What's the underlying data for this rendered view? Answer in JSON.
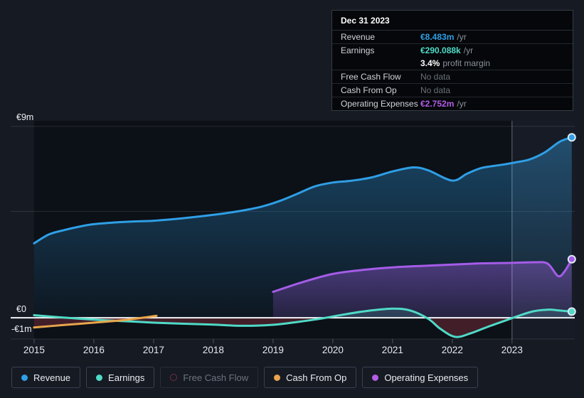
{
  "tooltip": {
    "date": "Dec 31 2023",
    "revenue": {
      "label": "Revenue",
      "value": "€8.483m",
      "suffix": "/yr"
    },
    "earnings": {
      "label": "Earnings",
      "value": "€290.088k",
      "suffix": "/yr",
      "margin_value": "3.4%",
      "margin_label": "profit margin"
    },
    "free_cash_flow": {
      "label": "Free Cash Flow",
      "value": "No data"
    },
    "cash_from_op": {
      "label": "Cash From Op",
      "value": "No data"
    },
    "operating_expenses": {
      "label": "Operating Expenses",
      "value": "€2.752m",
      "suffix": "/yr"
    }
  },
  "y_axis": {
    "top": "€9m",
    "zero": "€0",
    "bottom": "-€1m"
  },
  "legend": {
    "items": [
      {
        "label": "Revenue",
        "key": "revenue"
      },
      {
        "label": "Earnings",
        "key": "earnings"
      },
      {
        "label": "Free Cash Flow",
        "key": "fcf"
      },
      {
        "label": "Cash From Op",
        "key": "cashop"
      },
      {
        "label": "Operating Expenses",
        "key": "opex"
      }
    ]
  },
  "colors": {
    "revenue": "#2f9fe6",
    "earnings": "#4fdac6",
    "opex": "#b45ce8",
    "cashop": "#e8a54b",
    "fcf": "#6e2f40",
    "background": "#161a23",
    "plot_dark": "#0c1017",
    "zero_line": "#f2f4f7"
  },
  "chart_data": {
    "type": "area",
    "title": "Earnings and revenue history",
    "currency": "EUR",
    "unit": "millions",
    "xlim": [
      2014.608,
      2024.05
    ],
    "ylim": [
      -1.0,
      9.26
    ],
    "x_ticks": [
      2015,
      2016,
      2017,
      2018,
      2019,
      2020,
      2021,
      2022,
      2023
    ],
    "y_gridlines": [
      9,
      5,
      -1
    ],
    "y_tick_labels": [
      {
        "text": "€9m",
        "value": 9
      },
      {
        "text": "€0",
        "value": 0
      },
      {
        "text": "-€1m",
        "value": -1
      }
    ],
    "highlight": {
      "from_year": 2023,
      "to_year": 2024.05
    },
    "series": [
      {
        "key": "revenue",
        "name": "Revenue",
        "color": "#2f9fe6",
        "end_marker": true,
        "points": [
          [
            2015,
            3.5
          ],
          [
            2015.25,
            3.92
          ],
          [
            2015.5,
            4.12
          ],
          [
            2015.75,
            4.28
          ],
          [
            2016,
            4.4
          ],
          [
            2016.35,
            4.48
          ],
          [
            2016.7,
            4.53
          ],
          [
            2017,
            4.56
          ],
          [
            2017.5,
            4.68
          ],
          [
            2018,
            4.84
          ],
          [
            2018.4,
            5.0
          ],
          [
            2018.8,
            5.22
          ],
          [
            2019.1,
            5.48
          ],
          [
            2019.4,
            5.82
          ],
          [
            2019.7,
            6.18
          ],
          [
            2020,
            6.36
          ],
          [
            2020.3,
            6.44
          ],
          [
            2020.65,
            6.6
          ],
          [
            2021,
            6.88
          ],
          [
            2021.35,
            7.07
          ],
          [
            2021.6,
            6.93
          ],
          [
            2022,
            6.45
          ],
          [
            2022.25,
            6.78
          ],
          [
            2022.5,
            7.05
          ],
          [
            2022.8,
            7.18
          ],
          [
            2023.05,
            7.3
          ],
          [
            2023.3,
            7.45
          ],
          [
            2023.55,
            7.78
          ],
          [
            2023.8,
            8.28
          ],
          [
            2024,
            8.483
          ]
        ]
      },
      {
        "key": "opex",
        "name": "Operating Expenses",
        "color": "#a55ce8",
        "end_marker": true,
        "points": [
          [
            2019,
            1.22
          ],
          [
            2019.5,
            1.68
          ],
          [
            2020,
            2.06
          ],
          [
            2020.5,
            2.25
          ],
          [
            2021,
            2.37
          ],
          [
            2021.5,
            2.44
          ],
          [
            2022,
            2.5
          ],
          [
            2022.5,
            2.56
          ],
          [
            2023,
            2.58
          ],
          [
            2023.4,
            2.61
          ],
          [
            2023.6,
            2.54
          ],
          [
            2023.77,
            1.96
          ],
          [
            2023.88,
            2.18
          ],
          [
            2024,
            2.752
          ]
        ]
      },
      {
        "key": "earnings",
        "name": "Earnings",
        "color": "#4fdac6",
        "end_marker": true,
        "pos_fill": "rgba(79,218,198,0.16)",
        "neg_fill": "rgba(214,72,94,0.27)",
        "points": [
          [
            2015,
            0.12
          ],
          [
            2015.4,
            0.03
          ],
          [
            2015.8,
            -0.05
          ],
          [
            2016.2,
            -0.12
          ],
          [
            2016.6,
            -0.17
          ],
          [
            2017,
            -0.23
          ],
          [
            2017.5,
            -0.28
          ],
          [
            2018,
            -0.32
          ],
          [
            2018.5,
            -0.38
          ],
          [
            2019,
            -0.33
          ],
          [
            2019.4,
            -0.2
          ],
          [
            2019.8,
            -0.04
          ],
          [
            2020.2,
            0.16
          ],
          [
            2020.6,
            0.33
          ],
          [
            2021,
            0.43
          ],
          [
            2021.3,
            0.34
          ],
          [
            2021.6,
            -0.05
          ],
          [
            2021.8,
            -0.52
          ],
          [
            2022.05,
            -0.9
          ],
          [
            2022.3,
            -0.74
          ],
          [
            2022.6,
            -0.42
          ],
          [
            2022.9,
            -0.12
          ],
          [
            2023.1,
            0.08
          ],
          [
            2023.35,
            0.3
          ],
          [
            2023.6,
            0.38
          ],
          [
            2023.8,
            0.34
          ],
          [
            2024,
            0.29
          ]
        ]
      },
      {
        "key": "cashop",
        "name": "Cash From Op",
        "color": "#e8a54b",
        "end_marker": false,
        "neg_fill": "rgba(214,72,94,0.27)",
        "points": [
          [
            2015,
            -0.46
          ],
          [
            2015.5,
            -0.34
          ],
          [
            2016,
            -0.23
          ],
          [
            2016.5,
            -0.11
          ],
          [
            2017.05,
            0.09
          ]
        ]
      }
    ]
  }
}
